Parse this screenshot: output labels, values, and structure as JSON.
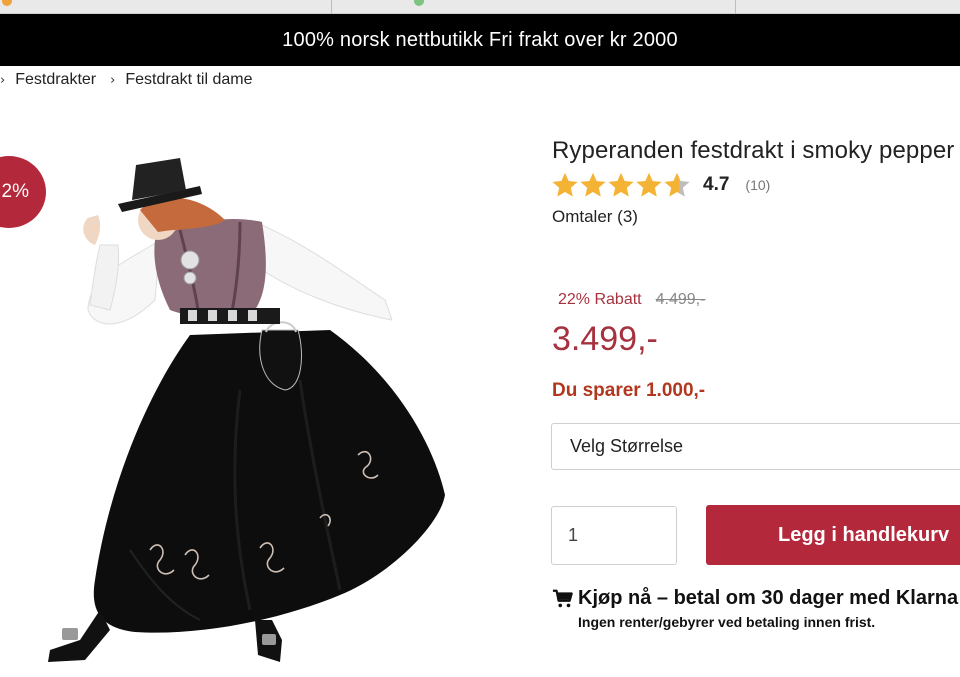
{
  "topbar": {
    "text": "100% norsk nettbutikk  Fri frakt over kr 2000"
  },
  "breadcrumb": {
    "items": [
      "Festdrakter",
      "Festdrakt til dame"
    ]
  },
  "badge": {
    "text": "2%"
  },
  "product": {
    "title": "Ryperanden festdrakt i smoky pepper",
    "rating": {
      "value": "4.7",
      "count": "(10)",
      "stars_filled_fraction": 0.94
    },
    "reviews_link": "Omtaler (3)",
    "discount_text": "22% Rabatt",
    "old_price": "4.499,-",
    "current_price": "3.499,-",
    "savings": "Du sparer 1.000,-",
    "size_select": "Velg Størrelse",
    "quantity": "1",
    "add_to_cart": "Legg i handlekurv",
    "klarna_title": "Kjøp nå – betal om 30 dager med Klarna",
    "klarna_sub": "Ingen renter/gebyrer ved betaling innen frist."
  },
  "colors": {
    "accent": "#b4283b",
    "price": "#a6323f",
    "savings": "#b1371f",
    "star": "#f5b335",
    "topbar_bg": "#000000"
  },
  "icons": [
    "cart-icon",
    "star-icon",
    "chevron-right-icon"
  ]
}
